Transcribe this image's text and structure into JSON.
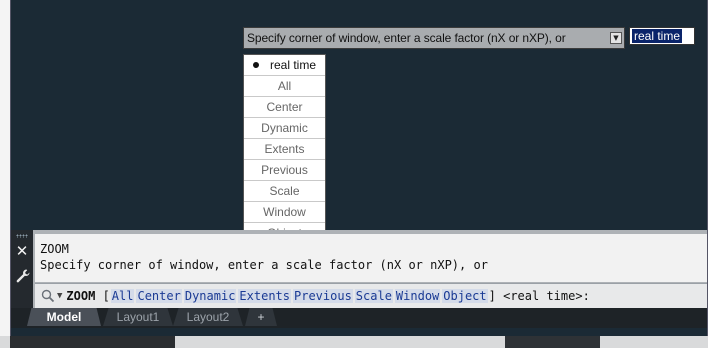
{
  "dynamic_input": {
    "prompt": "Specify corner of window, enter a scale factor (nX or nXP), or",
    "value": "real time",
    "dropdown_arrow_icon": "down-arrow-icon"
  },
  "options_menu": {
    "items": [
      {
        "label": "real time",
        "selected": true
      },
      {
        "label": "All",
        "selected": false
      },
      {
        "label": "Center",
        "selected": false
      },
      {
        "label": "Dynamic",
        "selected": false
      },
      {
        "label": "Extents",
        "selected": false
      },
      {
        "label": "Previous",
        "selected": false
      },
      {
        "label": "Scale",
        "selected": false
      },
      {
        "label": "Window",
        "selected": false
      },
      {
        "label": "Object",
        "selected": false
      }
    ]
  },
  "command_line": {
    "history": [
      "ZOOM",
      "Specify corner of window, enter a scale factor (nX or nXP), or"
    ],
    "command": "ZOOM",
    "open_bracket": "[",
    "options": [
      "All",
      "Center",
      "Dynamic",
      "Extents",
      "Previous",
      "Scale",
      "Window",
      "Object"
    ],
    "close_bracket": "]",
    "default": "<real time>:",
    "icons": [
      "close-icon",
      "customize-wrench-icon",
      "zoom-icon"
    ]
  },
  "layout_tabs": {
    "tabs": [
      {
        "label": "Model",
        "active": true
      },
      {
        "label": "Layout1",
        "active": false
      },
      {
        "label": "Layout2",
        "active": false
      }
    ],
    "add_label": "+"
  },
  "colors": {
    "canvas_background": "#1b2a35",
    "option_keyword": "#1a3a94",
    "selection": "#0a246a"
  }
}
